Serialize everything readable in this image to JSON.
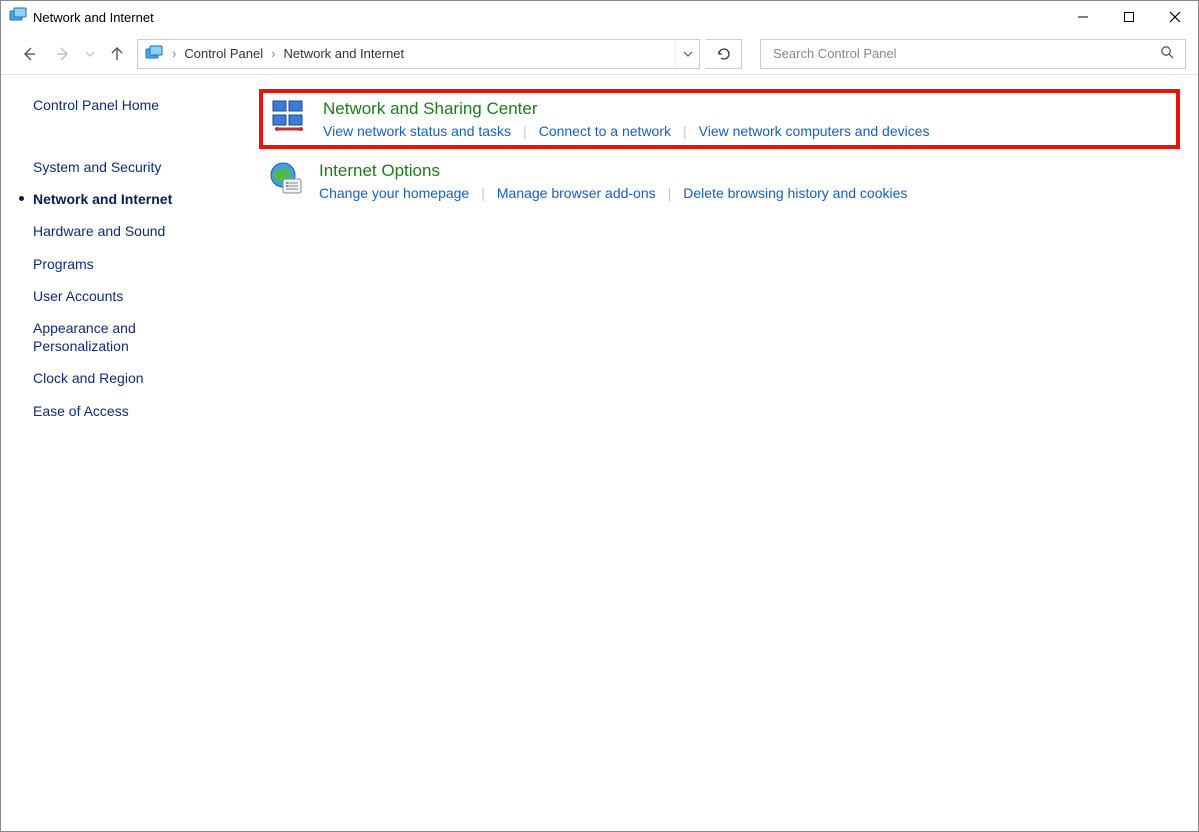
{
  "window": {
    "title": "Network and Internet"
  },
  "breadcrumb": {
    "parts": [
      "Control Panel",
      "Network and Internet"
    ]
  },
  "search": {
    "placeholder": "Search Control Panel"
  },
  "sidebar": {
    "home_label": "Control Panel Home",
    "items": [
      {
        "label": "System and Security",
        "current": false
      },
      {
        "label": "Network and Internet",
        "current": true
      },
      {
        "label": "Hardware and Sound",
        "current": false
      },
      {
        "label": "Programs",
        "current": false
      },
      {
        "label": "User Accounts",
        "current": false
      },
      {
        "label": "Appearance and Personalization",
        "current": false
      },
      {
        "label": "Clock and Region",
        "current": false
      },
      {
        "label": "Ease of Access",
        "current": false
      }
    ]
  },
  "panels": [
    {
      "title": "Network and Sharing Center",
      "icon": "network-sharing-icon",
      "highlight": true,
      "tasks": [
        "View network status and tasks",
        "Connect to a network",
        "View network computers and devices"
      ]
    },
    {
      "title": "Internet Options",
      "icon": "internet-options-icon",
      "highlight": false,
      "tasks": [
        "Change your homepage",
        "Manage browser add-ons",
        "Delete browsing history and cookies"
      ]
    }
  ]
}
